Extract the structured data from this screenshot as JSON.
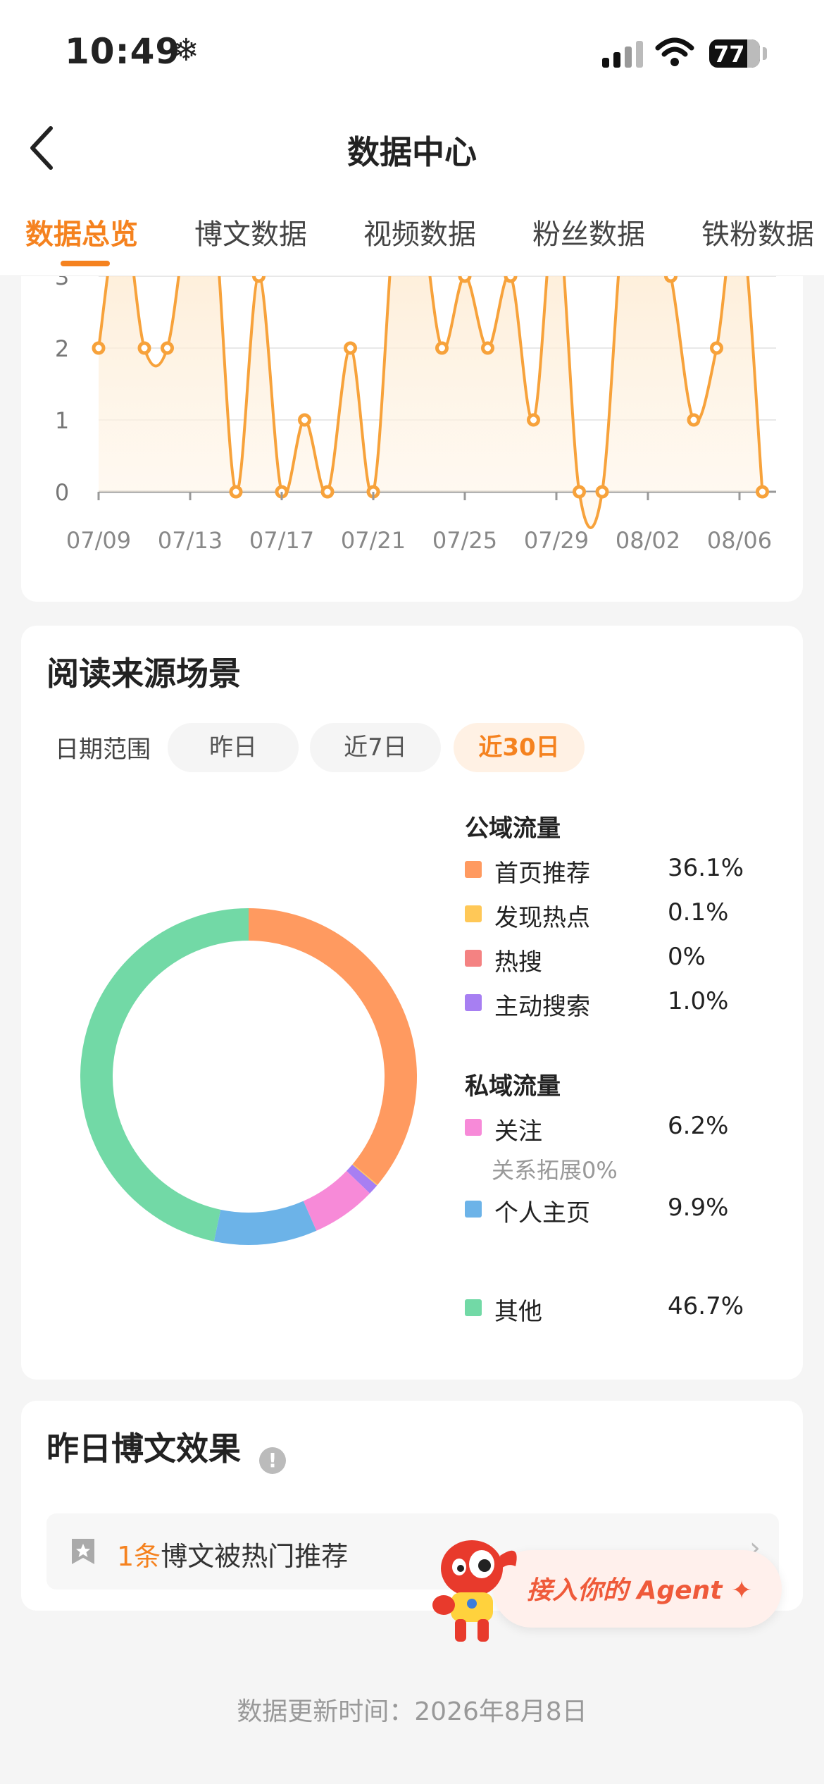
{
  "status_bar": {
    "time": "10:49",
    "snow": "❄",
    "battery": "77"
  },
  "header": {
    "title": "数据中心"
  },
  "tabs": [
    {
      "label": "数据总览",
      "active": true
    },
    {
      "label": "博文数据"
    },
    {
      "label": "视频数据"
    },
    {
      "label": "粉丝数据"
    },
    {
      "label": "铁粉数据"
    }
  ],
  "chart_data": {
    "type": "line",
    "ytick_labels": [
      "0",
      "1",
      "2",
      "3"
    ],
    "xtick_labels": [
      "07/09",
      "07/13",
      "07/17",
      "07/21",
      "07/25",
      "07/29",
      "08/02",
      "08/06"
    ],
    "ylim_visible": [
      0,
      3
    ],
    "x": [
      "07/09",
      "07/10",
      "07/11",
      "07/12",
      "07/13",
      "07/14",
      "07/15",
      "07/16",
      "07/17",
      "07/18",
      "07/19",
      "07/20",
      "07/21",
      "07/22",
      "07/23",
      "07/24",
      "07/25",
      "07/26",
      "07/27",
      "07/28",
      "07/29",
      "07/30",
      "07/31",
      "08/01",
      "08/02",
      "08/03",
      "08/04",
      "08/05",
      "08/06",
      "08/07"
    ],
    "values": [
      2,
      4,
      2,
      2,
      4,
      4,
      0,
      3,
      0,
      1,
      0,
      2,
      0,
      4,
      4,
      2,
      3,
      2,
      3,
      1,
      4,
      0,
      0,
      4,
      4,
      3,
      1,
      2,
      4,
      0
    ],
    "series_color": "#f7a23b",
    "grid": true
  },
  "source": {
    "title": "阅读来源场景",
    "date_label": "日期范围",
    "pills": [
      {
        "label": "昨日"
      },
      {
        "label": "近7日"
      },
      {
        "label": "近30日",
        "active": true
      }
    ],
    "public_group": "公域流量",
    "private_group": "私域流量",
    "items": [
      {
        "label": "首页推荐",
        "value": "36.1%",
        "color": "#ff9a60"
      },
      {
        "label": "发现热点",
        "value": "0.1%",
        "color": "#ffc857"
      },
      {
        "label": "热搜",
        "value": "0%",
        "color": "#f48282"
      },
      {
        "label": "主动搜索",
        "value": "1.0%",
        "color": "#a77ff2"
      },
      {
        "label": "关注",
        "value": "6.2%",
        "color": "#f78ad8"
      },
      {
        "label": "个人主页",
        "value": "9.9%",
        "color": "#6cb3e8"
      },
      {
        "label": "其他",
        "value": "46.7%",
        "color": "#72d9a6"
      }
    ],
    "follow_sub": "关系拓展0%"
  },
  "effect": {
    "title": "昨日博文效果",
    "info": "!",
    "count": "1条",
    "text": "博文被热门推荐",
    "chevron": "›"
  },
  "agent": {
    "label": "接入你的 Agent ✦"
  },
  "footer": {
    "text": "数据更新时间：2026年8月8日"
  }
}
